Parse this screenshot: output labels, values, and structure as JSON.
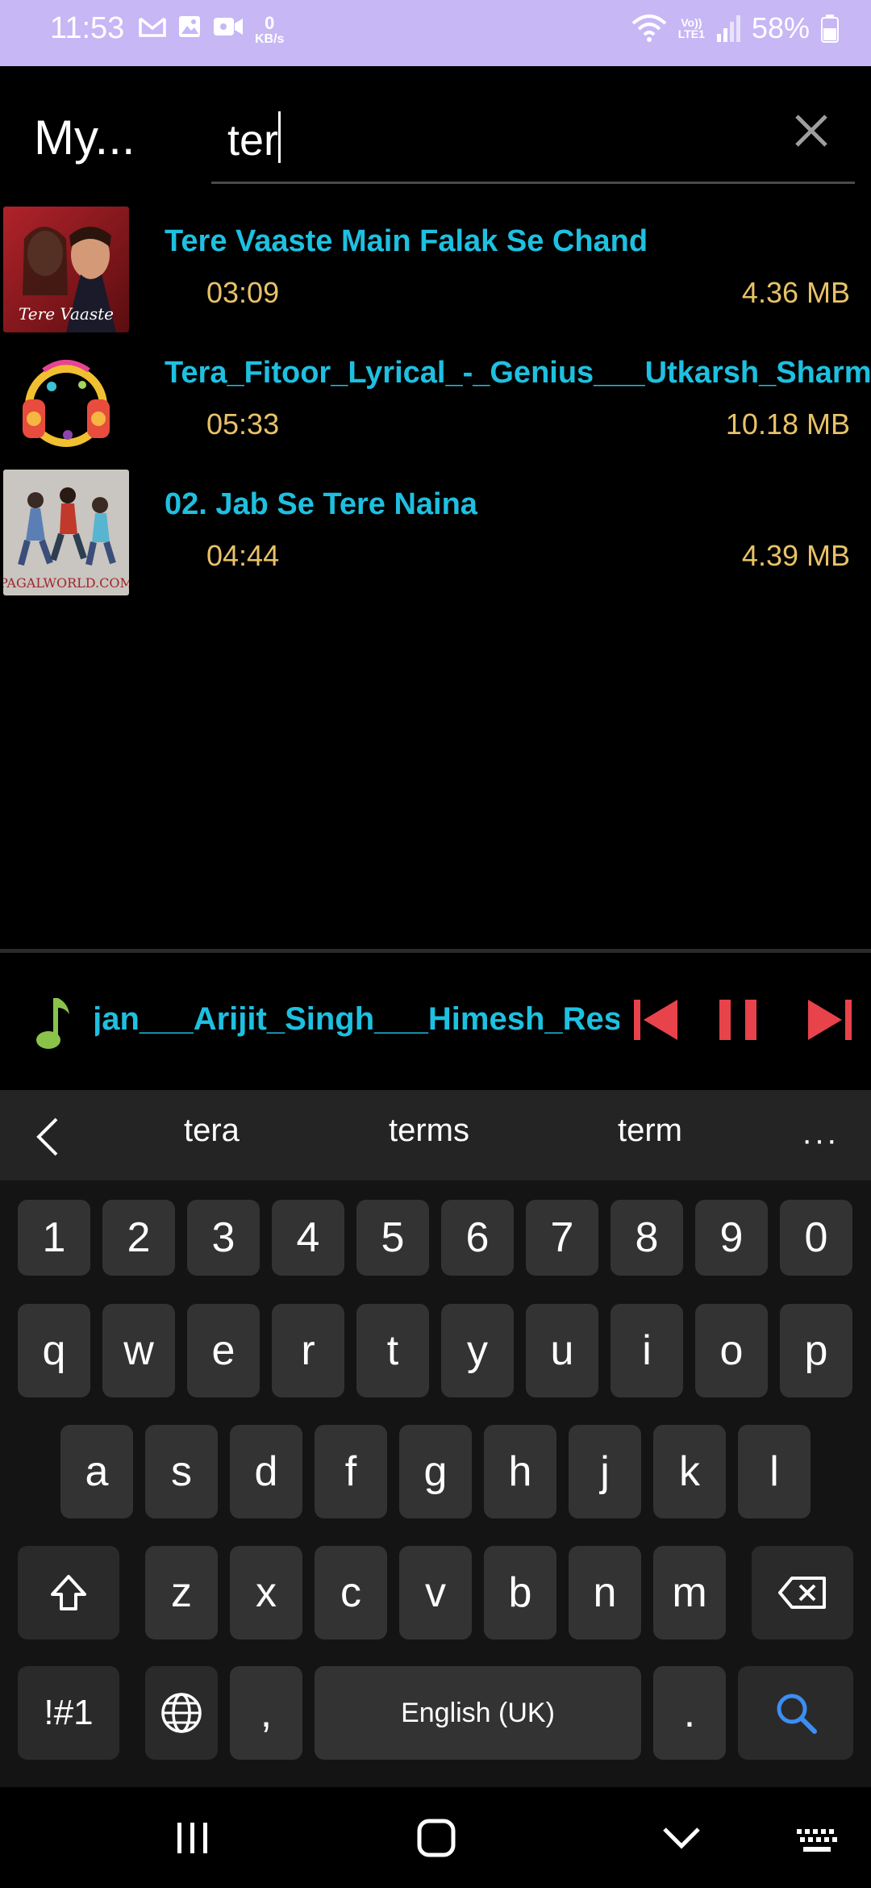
{
  "status_bar": {
    "time": "11:53",
    "kb_rate_value": "0",
    "kb_rate_unit": "KB/s",
    "network_top": "Vo))",
    "network_bottom": "LTE1",
    "battery": "58%"
  },
  "header": {
    "title": "My...",
    "search_value": "ter"
  },
  "songs": [
    {
      "title": "Tere Vaaste Main Falak Se Chand",
      "duration": "03:09",
      "size": "4.36 MB",
      "thumb_text": "Tere Vaaste"
    },
    {
      "title": "Tera_Fitoor_Lyrical_-_Genius___Utkarsh_Sharma",
      "duration": "05:33",
      "size": "10.18 MB"
    },
    {
      "title": "02. Jab Se Tere Naina",
      "duration": "04:44",
      "size": "4.39 MB",
      "thumb_text": "PAGALWORLD.COM"
    }
  ],
  "player": {
    "now_playing": "Saajan___Arijit_Singh___Himesh_Reshammiya",
    "accent": "#e8424a"
  },
  "keyboard": {
    "suggestions": [
      "tera",
      "terms",
      "term"
    ],
    "more": "···",
    "number_row": [
      "1",
      "2",
      "3",
      "4",
      "5",
      "6",
      "7",
      "8",
      "9",
      "0"
    ],
    "row1": [
      "q",
      "w",
      "e",
      "r",
      "t",
      "y",
      "u",
      "i",
      "o",
      "p"
    ],
    "row2": [
      "a",
      "s",
      "d",
      "f",
      "g",
      "h",
      "j",
      "k",
      "l"
    ],
    "row3": [
      "z",
      "x",
      "c",
      "v",
      "b",
      "n",
      "m"
    ],
    "symbols_key": "!#1",
    "comma_key": ",",
    "space_label": "English (UK)",
    "period_key": "."
  },
  "colors": {
    "status_bar": "#c7b7f5",
    "title_text": "#1ec0e0",
    "meta_text": "#e8c268",
    "note_icon": "#8bc34a",
    "search_action": "#3d8ef2"
  }
}
